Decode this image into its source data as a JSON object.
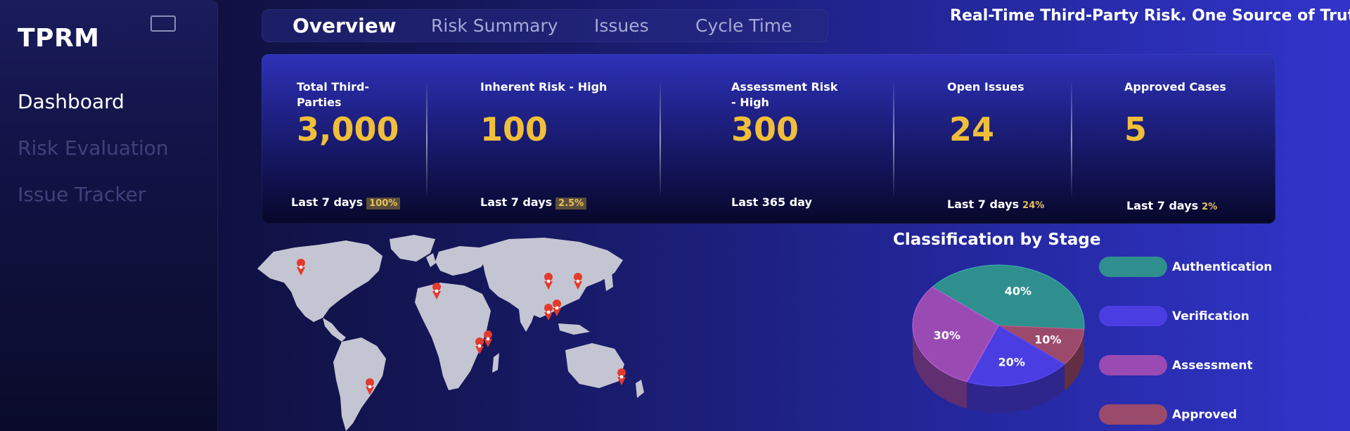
{
  "sidebar": {
    "brand": "TPRM",
    "items": [
      {
        "label": "Dashboard",
        "active": true
      },
      {
        "label": "Risk Evaluation",
        "active": false
      },
      {
        "label": "Issue Tracker",
        "active": false
      }
    ]
  },
  "tabs": [
    {
      "label": "Overview",
      "active": true
    },
    {
      "label": "Risk Summary",
      "active": false
    },
    {
      "label": "Issues",
      "active": false
    },
    {
      "label": "Cycle Time",
      "active": false
    }
  ],
  "tagline": "Real-Time Third-Party Risk. One Source of Truth.",
  "kpis": [
    {
      "label": "Total Third-Parties",
      "value": "3,000",
      "period": "Last 7 days",
      "change": "100%"
    },
    {
      "label": "Inherent Risk - High",
      "value": "100",
      "period": "Last 7 days",
      "change": "2.5%"
    },
    {
      "label": "Assessment Risk - High",
      "value": "300",
      "period": "Last 365 day",
      "change": ""
    },
    {
      "label": "Open Issues",
      "value": "24",
      "period": "Last 7 days",
      "change": "24%"
    },
    {
      "label": "Approved Cases",
      "value": "5",
      "period": "Last 7 days",
      "change": "2%"
    }
  ],
  "stage_chart": {
    "title": "Classification by Stage",
    "slices": [
      {
        "label": "Authentication",
        "value": 40,
        "display": "40%",
        "color": "#2f8f8e"
      },
      {
        "label": "Verification",
        "value": 20,
        "display": "20%",
        "color": "#4a3ee3"
      },
      {
        "label": "Assessment",
        "value": 30,
        "display": "30%",
        "color": "#9a4bb3"
      },
      {
        "label": "Approved",
        "value": 10,
        "display": "10%",
        "color": "#9c4a6c"
      }
    ]
  },
  "colors": {
    "accent": "#f0bf3a",
    "pin": "#e23b2e",
    "land": "#c4c5d2"
  }
}
